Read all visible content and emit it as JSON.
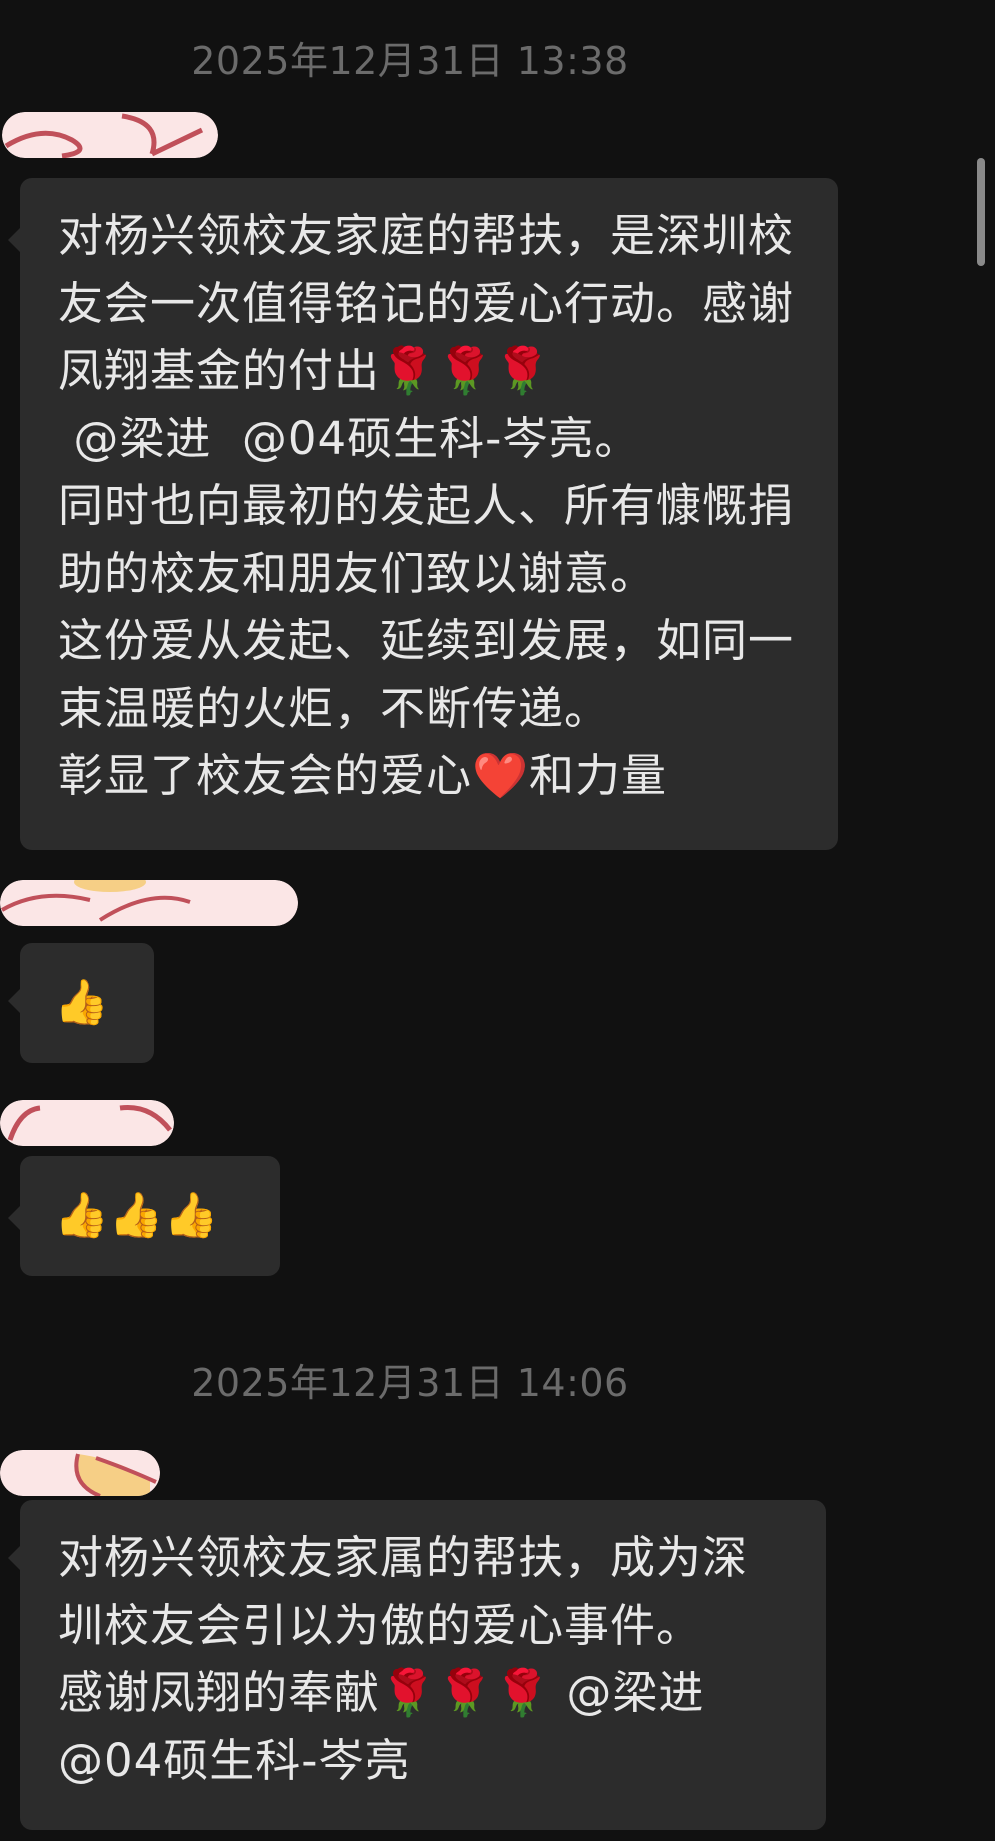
{
  "timestamps": [
    "2025年12月31日 13:38",
    "2025年12月31日 14:06"
  ],
  "messages": [
    {
      "sender_name": "",
      "text": "对杨兴领校友家庭的帮扶，是深圳校友会一次值得铭记的爱心行动。感谢凤翔基金的付出🌹🌹🌹\n @梁进  @04硕生科-岑亮。\n同时也向最初的发起人、所有慷慨捐助的校友和朋友们致以谢意。\n这份爱从发起、延续到发展，如同一束温暖的火炬，不断传递。\n彰显了校友会的爱心❤️和力量"
    },
    {
      "sender_name": "",
      "text": "👍"
    },
    {
      "sender_name": "",
      "text": "👍👍👍"
    },
    {
      "sender_name": "",
      "text": "对杨兴领校友家属的帮扶，成为深圳校友会引以为傲的爱心事件。\n感谢凤翔的奉献🌹🌹🌹 @梁进\n@04硕生科-岑亮"
    }
  ],
  "colors": {
    "background": "#111111",
    "bubble": "#2c2c2c",
    "message_text": "#e8e8e8",
    "timestamp_text": "#6b6b6b",
    "scribble_fill": "#fbe6e6",
    "scribble_stroke": "#c0505a",
    "scribble_yellow": "#f6cf86"
  }
}
